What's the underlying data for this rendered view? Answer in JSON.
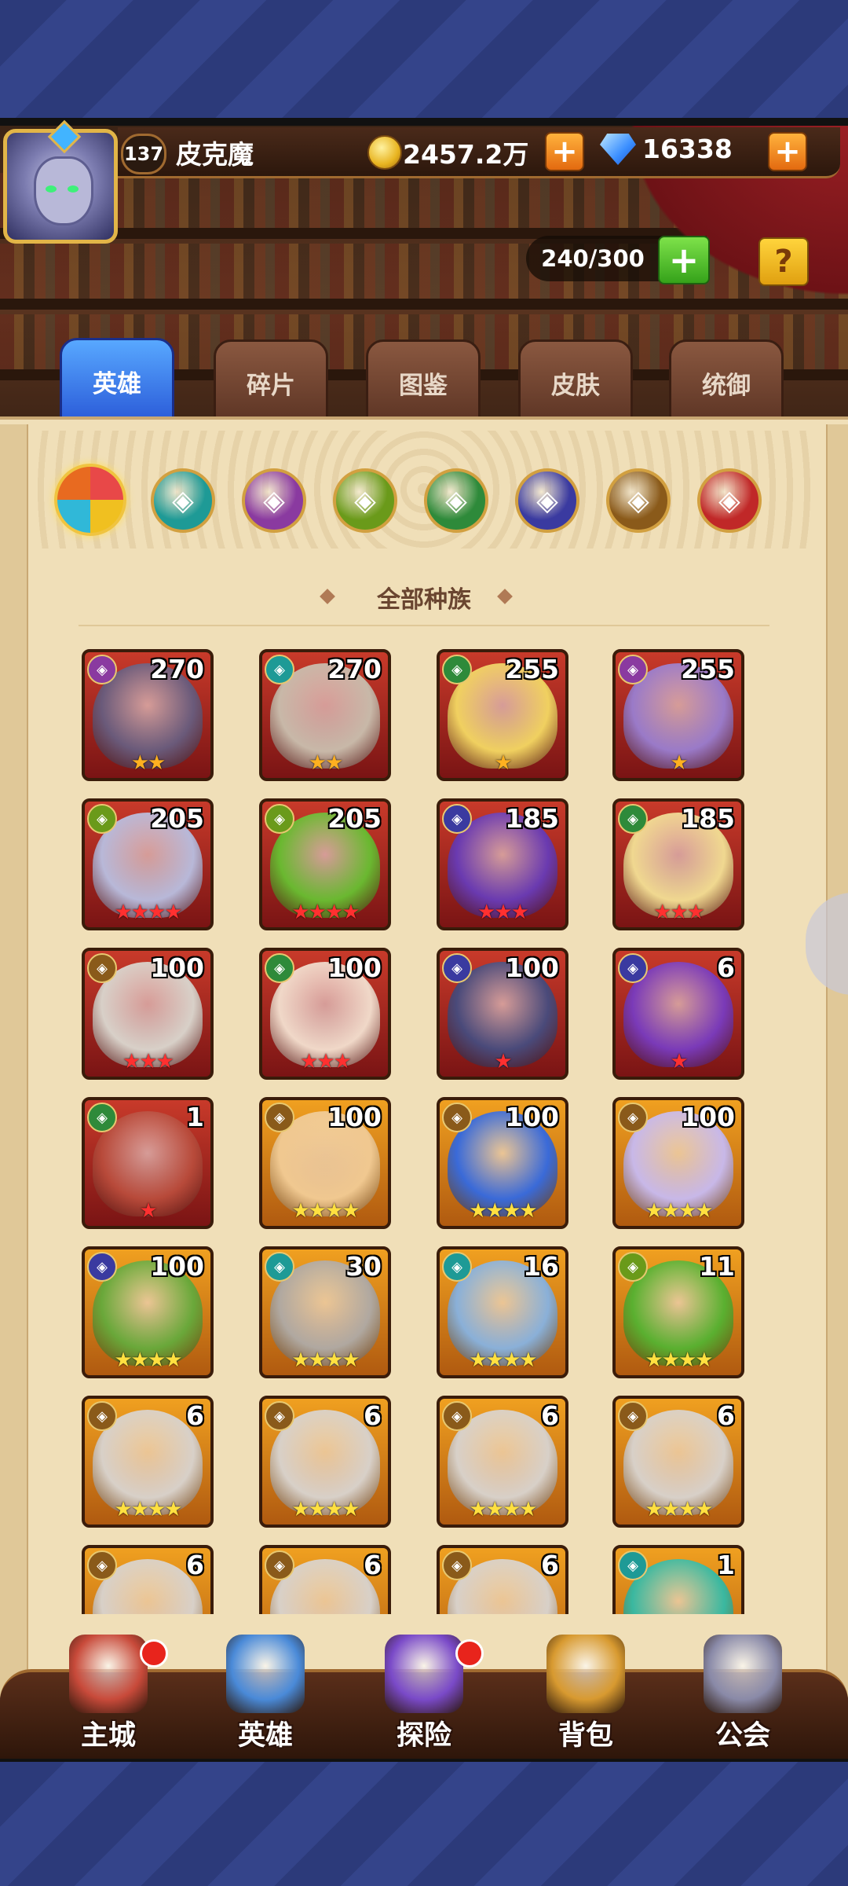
{
  "player": {
    "level": "137",
    "name": "皮克魔"
  },
  "currency": {
    "gold": "2457.2万",
    "gems": "16338",
    "plus": "+"
  },
  "hero_capacity": {
    "value": "240/300",
    "plus": "+",
    "help": "?"
  },
  "tabs": [
    {
      "label": "英雄",
      "active": true
    },
    {
      "label": "碎片",
      "active": false
    },
    {
      "label": "图鉴",
      "active": false
    },
    {
      "label": "皮肤",
      "active": false
    },
    {
      "label": "统御",
      "active": false
    }
  ],
  "factions": [
    {
      "icon": "all-factions-icon",
      "color": "#e84848",
      "active": true
    },
    {
      "icon": "teal-faction-icon",
      "color": "#1e9a96"
    },
    {
      "icon": "purple-faction-icon",
      "color": "#8a3aa0"
    },
    {
      "icon": "green-eye-faction-icon",
      "color": "#6a9a1a"
    },
    {
      "icon": "forest-faction-icon",
      "color": "#2e8a3a"
    },
    {
      "icon": "dark-faction-icon",
      "color": "#3a3aa0"
    },
    {
      "icon": "light-faction-icon",
      "color": "#8a5a1a"
    },
    {
      "icon": "fire-faction-icon",
      "color": "#c02828"
    }
  ],
  "filter_label": "全部种族",
  "heroes": [
    {
      "level": "270",
      "stars": "★★",
      "star_color": "orange",
      "frame": "red",
      "faction": "purple",
      "portrait": "#6a5a7a"
    },
    {
      "level": "270",
      "stars": "★★",
      "star_color": "orange",
      "frame": "red",
      "faction": "teal",
      "portrait": "#c8b8a8"
    },
    {
      "level": "255",
      "stars": "★",
      "star_color": "orange",
      "frame": "red",
      "faction": "green",
      "portrait": "#f0d060"
    },
    {
      "level": "255",
      "stars": "★",
      "star_color": "orange",
      "frame": "red",
      "faction": "purple",
      "portrait": "#9a7ac8"
    },
    {
      "level": "205",
      "stars": "★★★★",
      "star_color": "red",
      "frame": "red",
      "faction": "olive",
      "portrait": "#b8b8d8"
    },
    {
      "level": "205",
      "stars": "★★★★",
      "star_color": "red",
      "frame": "red",
      "faction": "olive",
      "portrait": "#6ab830"
    },
    {
      "level": "185",
      "stars": "★★★",
      "star_color": "red",
      "frame": "red",
      "faction": "dark",
      "portrait": "#6a3ab0"
    },
    {
      "level": "185",
      "stars": "★★★",
      "star_color": "red",
      "frame": "red",
      "faction": "green",
      "portrait": "#f0d890"
    },
    {
      "level": "100",
      "stars": "★★★",
      "star_color": "red",
      "frame": "red",
      "faction": "light",
      "portrait": "#d8d0c8"
    },
    {
      "level": "100",
      "stars": "★★★",
      "star_color": "red",
      "frame": "red",
      "faction": "green",
      "portrait": "#f0d8c8"
    },
    {
      "level": "100",
      "stars": "★",
      "star_color": "red",
      "frame": "red",
      "faction": "dark",
      "portrait": "#4a4a7a"
    },
    {
      "level": "6",
      "stars": "★",
      "star_color": "red",
      "frame": "red",
      "faction": "dark",
      "portrait": "#7a3ab8"
    },
    {
      "level": "1",
      "stars": "★",
      "star_color": "red",
      "frame": "red",
      "faction": "green",
      "portrait": "#b84a3a"
    },
    {
      "level": "100",
      "stars": "★★★★",
      "star_color": "yellow",
      "frame": "gold",
      "faction": "light",
      "portrait": "#f0c890"
    },
    {
      "level": "100",
      "stars": "★★★★",
      "star_color": "yellow",
      "frame": "gold",
      "faction": "light",
      "portrait": "#3a6ad8"
    },
    {
      "level": "100",
      "stars": "★★★★",
      "star_color": "yellow",
      "frame": "gold",
      "faction": "light",
      "portrait": "#c8b8e8"
    },
    {
      "level": "100",
      "stars": "★★★★",
      "star_color": "yellow",
      "frame": "gold",
      "faction": "dark",
      "portrait": "#6aa83a"
    },
    {
      "level": "30",
      "stars": "★★★★",
      "star_color": "yellow",
      "frame": "gold",
      "faction": "teal",
      "portrait": "#b0a8a0"
    },
    {
      "level": "16",
      "stars": "★★★★",
      "star_color": "yellow",
      "frame": "gold",
      "faction": "teal",
      "portrait": "#8ab0d8"
    },
    {
      "level": "11",
      "stars": "★★★★",
      "star_color": "yellow",
      "frame": "gold",
      "faction": "olive",
      "portrait": "#5ab030"
    },
    {
      "level": "6",
      "stars": "★★★★",
      "star_color": "yellow",
      "frame": "gold",
      "faction": "light",
      "portrait": "#d8d0c8"
    },
    {
      "level": "6",
      "stars": "★★★★",
      "star_color": "yellow",
      "frame": "gold",
      "faction": "light",
      "portrait": "#d8d0c8"
    },
    {
      "level": "6",
      "stars": "★★★★",
      "star_color": "yellow",
      "frame": "gold",
      "faction": "light",
      "portrait": "#d8d0c8"
    },
    {
      "level": "6",
      "stars": "★★★★",
      "star_color": "yellow",
      "frame": "gold",
      "faction": "light",
      "portrait": "#d8d0c8"
    },
    {
      "level": "6",
      "stars": "",
      "star_color": "yellow",
      "frame": "gold",
      "faction": "light",
      "portrait": "#d8d0c8"
    },
    {
      "level": "6",
      "stars": "",
      "star_color": "yellow",
      "frame": "gold",
      "faction": "light",
      "portrait": "#d8d0c8"
    },
    {
      "level": "6",
      "stars": "",
      "star_color": "yellow",
      "frame": "gold",
      "faction": "light",
      "portrait": "#d8d0c8"
    },
    {
      "level": "1",
      "stars": "",
      "star_color": "yellow",
      "frame": "gold",
      "faction": "teal",
      "portrait": "#3ab8a0"
    }
  ],
  "nav": [
    {
      "label": "主城",
      "icon": "castle-icon",
      "badge": true,
      "color": "#c84a3a"
    },
    {
      "label": "英雄",
      "icon": "hero-icon",
      "badge": false,
      "color": "#4a8ad8"
    },
    {
      "label": "探险",
      "icon": "portal-icon",
      "badge": true,
      "color": "#7a4ac8"
    },
    {
      "label": "背包",
      "icon": "backpack-icon",
      "badge": false,
      "color": "#d89a30"
    },
    {
      "label": "公会",
      "icon": "guild-icon",
      "badge": false,
      "color": "#8a8aa8"
    }
  ]
}
